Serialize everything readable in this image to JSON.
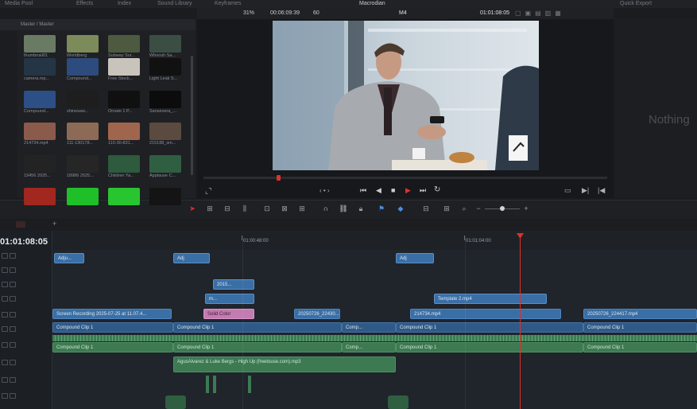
{
  "topbar": {
    "items": [
      "Media Pool",
      "Effects",
      "Index",
      "Sound Library",
      "Keyframes"
    ],
    "app_title": "Macrodian",
    "right_label": "Quick Export"
  },
  "viewer": {
    "zoom": "31%",
    "source_timecode": "00:06:09:39",
    "fps_dropdown": "60",
    "clip_name": "M4",
    "record_timecode": "01:01:08:05"
  },
  "media_pool": {
    "header": "Master / Master",
    "clips": [
      {
        "name": "thumbnail01",
        "color": "#6a7b63"
      },
      {
        "name": "Worldberg",
        "color": "#7d8a5a"
      },
      {
        "name": "Subway Sur...",
        "color": "#4e5a3f"
      },
      {
        "name": "Whoosh Sa...",
        "color": "#3a4e43"
      },
      {
        "name": "camera.mp...",
        "color": "#243546"
      },
      {
        "name": "Compound...",
        "color": "#2d4b7c"
      },
      {
        "name": "Free Stock...",
        "color": "#c9c4bb"
      },
      {
        "name": "Light Leak S...",
        "color": "#111111"
      },
      {
        "name": "Compound...",
        "color": "#2c4f86"
      },
      {
        "name": "shinesaw...",
        "color": "#1e1e1e"
      },
      {
        "name": "Ornate 1 P...",
        "color": "#101010"
      },
      {
        "name": "Sansevera_...",
        "color": "#0c0c0c"
      },
      {
        "name": "214734.mp4",
        "color": "#8a5a4a"
      },
      {
        "name": "111-130178...",
        "color": "#8d6a55"
      },
      {
        "name": "110-30-831...",
        "color": "#a0654d"
      },
      {
        "name": "215188_sm...",
        "color": "#5b4a40"
      },
      {
        "name": "19456 2025...",
        "color": "#232323"
      },
      {
        "name": "18986 2025...",
        "color": "#262626"
      },
      {
        "name": "Children Ya...",
        "color": "#2e5a3d"
      },
      {
        "name": "Applause C...",
        "color": "#2f5e40"
      },
      {
        "name": "",
        "color": "#a1271f"
      },
      {
        "name": "",
        "color": "#1fbf2a"
      },
      {
        "name": "",
        "color": "#28c530"
      },
      {
        "name": "",
        "color": "#141414"
      }
    ]
  },
  "inspector": {
    "empty_text": "Nothing"
  },
  "timeline": {
    "timecode": "01:01:08:05",
    "ruler_labels": [
      "01:00:48:00",
      "01:01:04:00"
    ],
    "clips": {
      "adj1": "Adju...",
      "adj2": "Adj",
      "adj3": "Adj",
      "fx1": "2015...",
      "fx2": "m...",
      "template": "Template 2.mp4",
      "screen_rec": "Screen Recording 2025-07-25 at 11.07.4...",
      "solid": "Solid Color",
      "clip_2025": "20250726_22430...",
      "clip_214734": "214734.mp4",
      "clip_right": "20250726_224417.mp4",
      "compound_v1a": "Compound Clip 1",
      "compound_v1b": "Compound Clip 1",
      "compound_v1c": "Comp...",
      "compound_v1d": "Compound Clip 1",
      "compound_v1e": "Compound Clip 1",
      "compound_a1a": "Compound Clip 1",
      "compound_a1b": "Compound Clip 1",
      "compound_a1c": "Comp...",
      "compound_a1d": "Compound Clip 1",
      "compound_a1e": "Compound Clip 1",
      "music": "AgusAlvarez & Luke Bergs - High Up (freetouse.com).mp3"
    }
  },
  "colors": {
    "playhead": "#e0302a",
    "video_clip": "#3a6fa6",
    "audio_clip": "#3d7a52",
    "solid_color_clip": "#c47bb0"
  }
}
